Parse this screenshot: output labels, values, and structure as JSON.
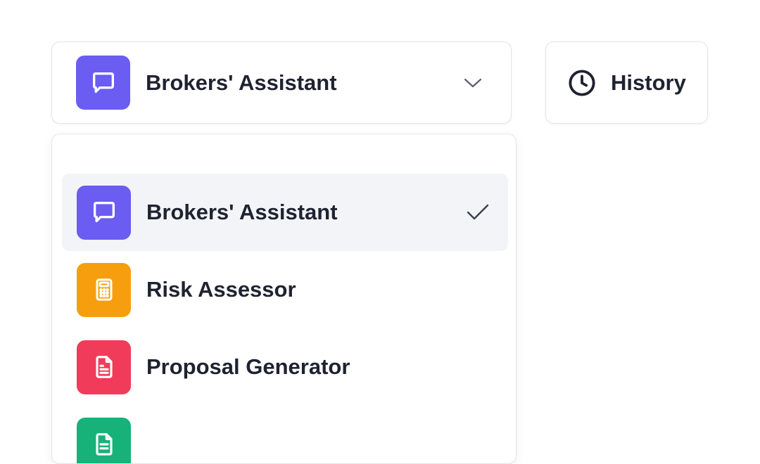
{
  "selector": {
    "current_label": "Brokers' Assistant",
    "icon": "message-square-icon",
    "accent": "#6b5cf2"
  },
  "history_button": {
    "label": "History",
    "icon": "clock-icon"
  },
  "dropdown": {
    "options": [
      {
        "label": "Brokers' Assistant",
        "icon": "message-square-icon",
        "color": "#6b5cf2",
        "selected": true
      },
      {
        "label": "Risk Assessor",
        "icon": "calculator-icon",
        "color": "#f79e0f",
        "selected": false
      },
      {
        "label": "Proposal Generator",
        "icon": "document-icon",
        "color": "#f03b5a",
        "selected": false
      },
      {
        "label": "",
        "icon": "document-icon",
        "color": "#17b27a",
        "selected": false
      }
    ]
  }
}
